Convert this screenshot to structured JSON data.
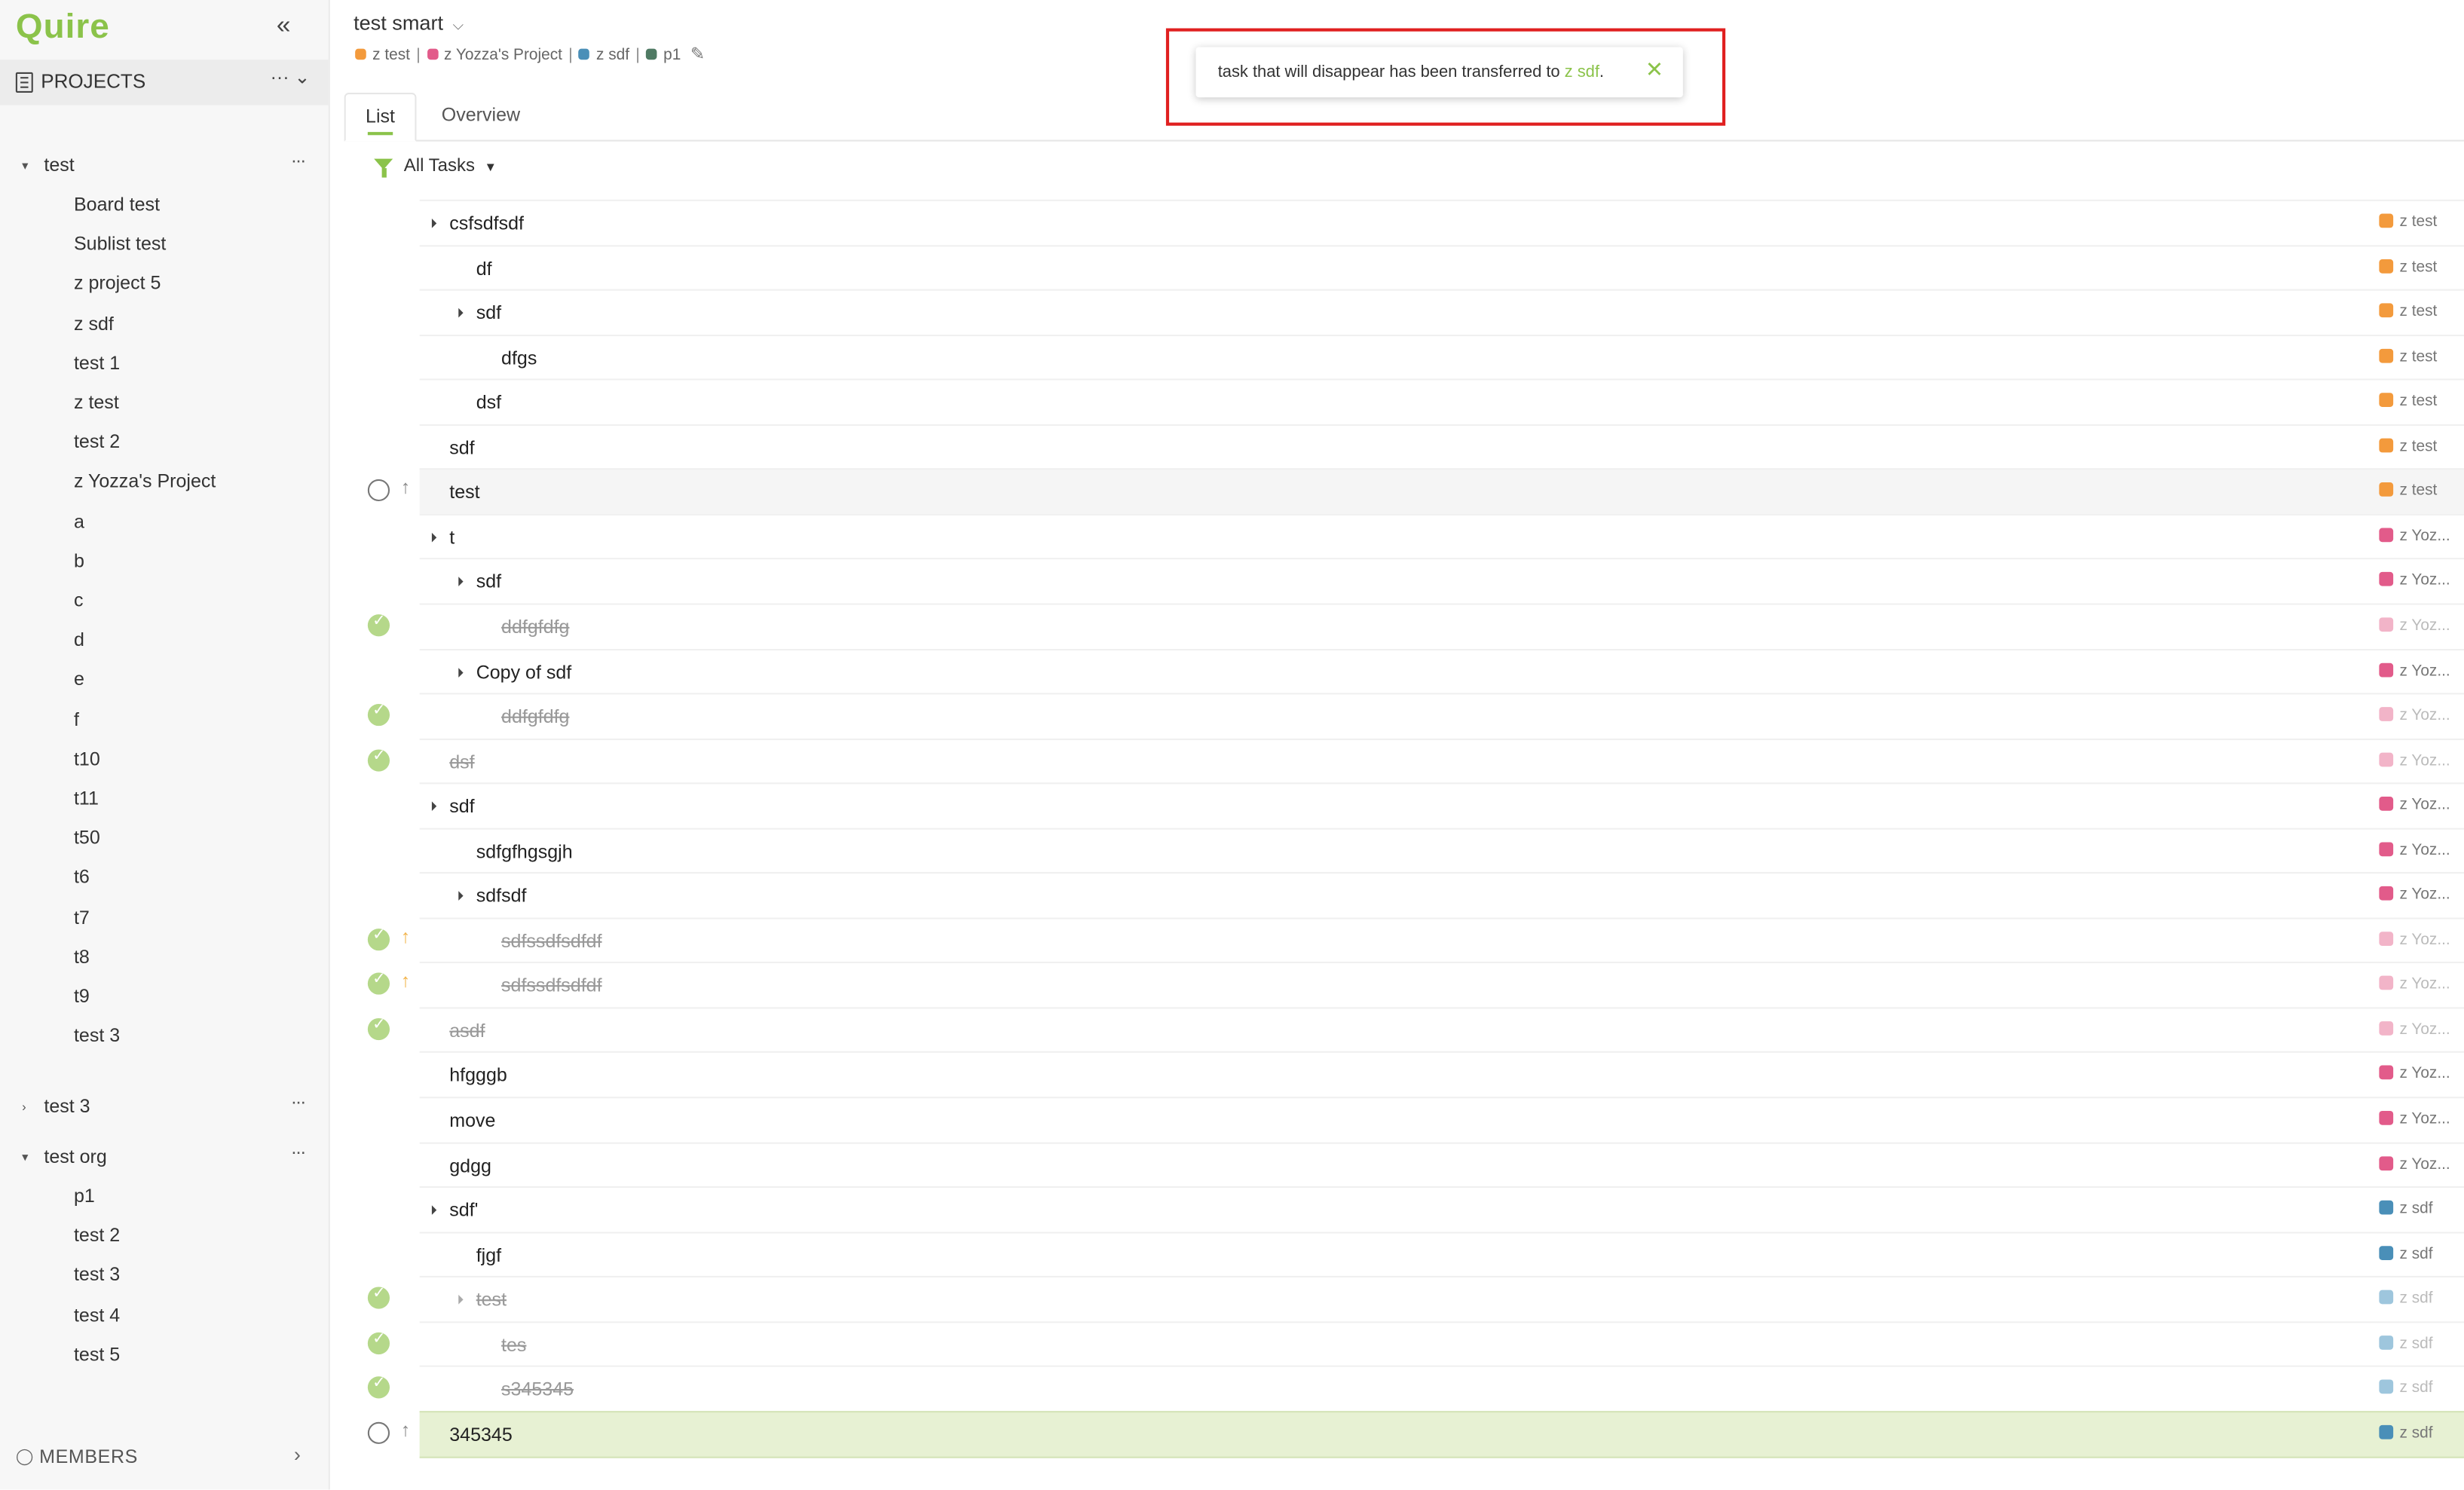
{
  "app": {
    "logo": "Quire",
    "collapse_icon": "double-chevron-left-icon"
  },
  "sidebar": {
    "projects_label": "PROJECTS",
    "more_label": "··· ⌄",
    "groups": [
      {
        "name": "test",
        "expanded": true,
        "items": [
          "Board test",
          "Sublist test",
          "z project 5",
          "z sdf",
          "test 1",
          "z test",
          "test 2",
          "z Yozza's Project",
          "a",
          "b",
          "c",
          "d",
          "e",
          "f",
          "t10",
          "t11",
          "t50",
          "t6",
          "t7",
          "t8",
          "t9",
          "test 3"
        ]
      },
      {
        "name": "test 3",
        "expanded": false,
        "items": []
      },
      {
        "name": "test org",
        "expanded": true,
        "items": [
          "p1",
          "test 2",
          "test 3",
          "test 4",
          "test 5"
        ]
      }
    ],
    "group_more": "···",
    "members_label": "MEMBERS"
  },
  "header": {
    "title": "test smart",
    "crumbs": [
      {
        "name": "z test",
        "color": "#f39a3c"
      },
      {
        "name": "z Yozza's Project",
        "color": "#e25b8a"
      },
      {
        "name": "z sdf",
        "color": "#4a8fb8"
      },
      {
        "name": "p1",
        "color": "#4f7a63"
      }
    ],
    "separator": "|"
  },
  "tabs": [
    {
      "label": "List",
      "active": true
    },
    {
      "label": "Overview",
      "active": false
    }
  ],
  "toast": {
    "message": "task that will disappear has been transferred to ",
    "link": "z sdf",
    "suffix": "."
  },
  "filter": {
    "label": "All Tasks"
  },
  "colors": {
    "accent": "#8bc34a",
    "z_test": "#f39a3c",
    "z_yozza": "#e25b8a",
    "z_sdf": "#4a8fb8"
  },
  "tasks": [
    {
      "text": "csfsdfsdf",
      "level": 0,
      "caret": true,
      "done": false,
      "status": "",
      "arrow": "",
      "project": "z test",
      "color": "#f39a3c"
    },
    {
      "text": "df",
      "level": 1,
      "caret": false,
      "done": false,
      "status": "",
      "arrow": "",
      "project": "z test",
      "color": "#f39a3c"
    },
    {
      "text": "sdf",
      "level": 1,
      "caret": true,
      "done": false,
      "status": "",
      "arrow": "",
      "project": "z test",
      "color": "#f39a3c"
    },
    {
      "text": "dfgs",
      "level": 2,
      "caret": false,
      "done": false,
      "status": "",
      "arrow": "",
      "project": "z test",
      "color": "#f39a3c"
    },
    {
      "text": "dsf",
      "level": 1,
      "caret": false,
      "done": false,
      "status": "",
      "arrow": "",
      "project": "z test",
      "color": "#f39a3c"
    },
    {
      "text": "sdf",
      "level": 0,
      "caret": false,
      "done": false,
      "status": "",
      "arrow": "",
      "project": "z test",
      "color": "#f39a3c"
    },
    {
      "text": "test",
      "level": 0,
      "caret": false,
      "done": false,
      "status": "open",
      "arrow": "gray",
      "project": "z test",
      "color": "#f39a3c",
      "highlight": true
    },
    {
      "text": "t",
      "level": 0,
      "caret": true,
      "done": false,
      "status": "",
      "arrow": "",
      "project": "z Yoz...",
      "color": "#e25b8a"
    },
    {
      "text": "sdf",
      "level": 1,
      "caret": true,
      "done": false,
      "status": "",
      "arrow": "",
      "project": "z Yoz...",
      "color": "#e25b8a"
    },
    {
      "text": "ddfgfdfg",
      "level": 2,
      "caret": false,
      "done": true,
      "status": "done",
      "arrow": "",
      "project": "z Yoz...",
      "color": "#f2b4c8"
    },
    {
      "text": "Copy of sdf",
      "level": 1,
      "caret": true,
      "done": false,
      "status": "",
      "arrow": "",
      "project": "z Yoz...",
      "color": "#e25b8a"
    },
    {
      "text": "ddfgfdfg",
      "level": 2,
      "caret": false,
      "done": true,
      "status": "done",
      "arrow": "",
      "project": "z Yoz...",
      "color": "#f2b4c8"
    },
    {
      "text": "dsf",
      "level": 0,
      "caret": false,
      "done": true,
      "status": "done",
      "arrow": "",
      "project": "z Yoz...",
      "color": "#f2b4c8"
    },
    {
      "text": "sdf",
      "level": 0,
      "caret": true,
      "done": false,
      "status": "progress",
      "arrow": "",
      "project": "z Yoz...",
      "color": "#e25b8a"
    },
    {
      "text": "sdfgfhgsgjh",
      "level": 1,
      "caret": false,
      "done": false,
      "status": "progress",
      "arrow": "",
      "project": "z Yoz...",
      "color": "#e25b8a"
    },
    {
      "text": "sdfsdf",
      "level": 1,
      "caret": true,
      "done": false,
      "status": "",
      "arrow": "",
      "project": "z Yoz...",
      "color": "#e25b8a"
    },
    {
      "text": "sdfssdfsdfdf",
      "level": 2,
      "caret": false,
      "done": true,
      "status": "done",
      "arrow": "orange",
      "project": "z Yoz...",
      "color": "#f2b4c8"
    },
    {
      "text": "sdfssdfsdfdf",
      "level": 2,
      "caret": false,
      "done": true,
      "status": "done",
      "arrow": "orange",
      "project": "z Yoz...",
      "color": "#f2b4c8"
    },
    {
      "text": "asdf",
      "level": 0,
      "caret": false,
      "done": true,
      "status": "done",
      "arrow": "",
      "project": "z Yoz...",
      "color": "#f2b4c8"
    },
    {
      "text": "hfgggb",
      "level": 0,
      "caret": false,
      "done": false,
      "status": "",
      "arrow": "",
      "project": "z Yoz...",
      "color": "#e25b8a"
    },
    {
      "text": "move",
      "level": 0,
      "caret": false,
      "done": false,
      "status": "",
      "arrow": "",
      "project": "z Yoz...",
      "color": "#e25b8a"
    },
    {
      "text": "gdgg",
      "level": 0,
      "caret": false,
      "done": false,
      "status": "",
      "arrow": "",
      "project": "z Yoz...",
      "color": "#e25b8a"
    },
    {
      "text": "sdf'",
      "level": 0,
      "caret": true,
      "done": false,
      "status": "",
      "arrow": "",
      "project": "z sdf",
      "color": "#4a8fb8"
    },
    {
      "text": "fjgf",
      "level": 1,
      "caret": false,
      "done": false,
      "status": "",
      "arrow": "",
      "project": "z sdf",
      "color": "#4a8fb8"
    },
    {
      "text": "test",
      "level": 1,
      "caret": true,
      "done": true,
      "status": "done",
      "arrow": "",
      "project": "z sdf",
      "color": "#9ec6dd"
    },
    {
      "text": "tes",
      "level": 2,
      "caret": false,
      "done": true,
      "status": "done",
      "arrow": "",
      "project": "z sdf",
      "color": "#9ec6dd"
    },
    {
      "text": "s345345",
      "level": 2,
      "caret": false,
      "done": true,
      "status": "done",
      "arrow": "",
      "project": "z sdf",
      "color": "#9ec6dd"
    },
    {
      "text": "345345",
      "level": 0,
      "caret": false,
      "done": false,
      "status": "open",
      "arrow": "gray",
      "project": "z sdf",
      "color": "#4a8fb8",
      "selected": true
    }
  ]
}
